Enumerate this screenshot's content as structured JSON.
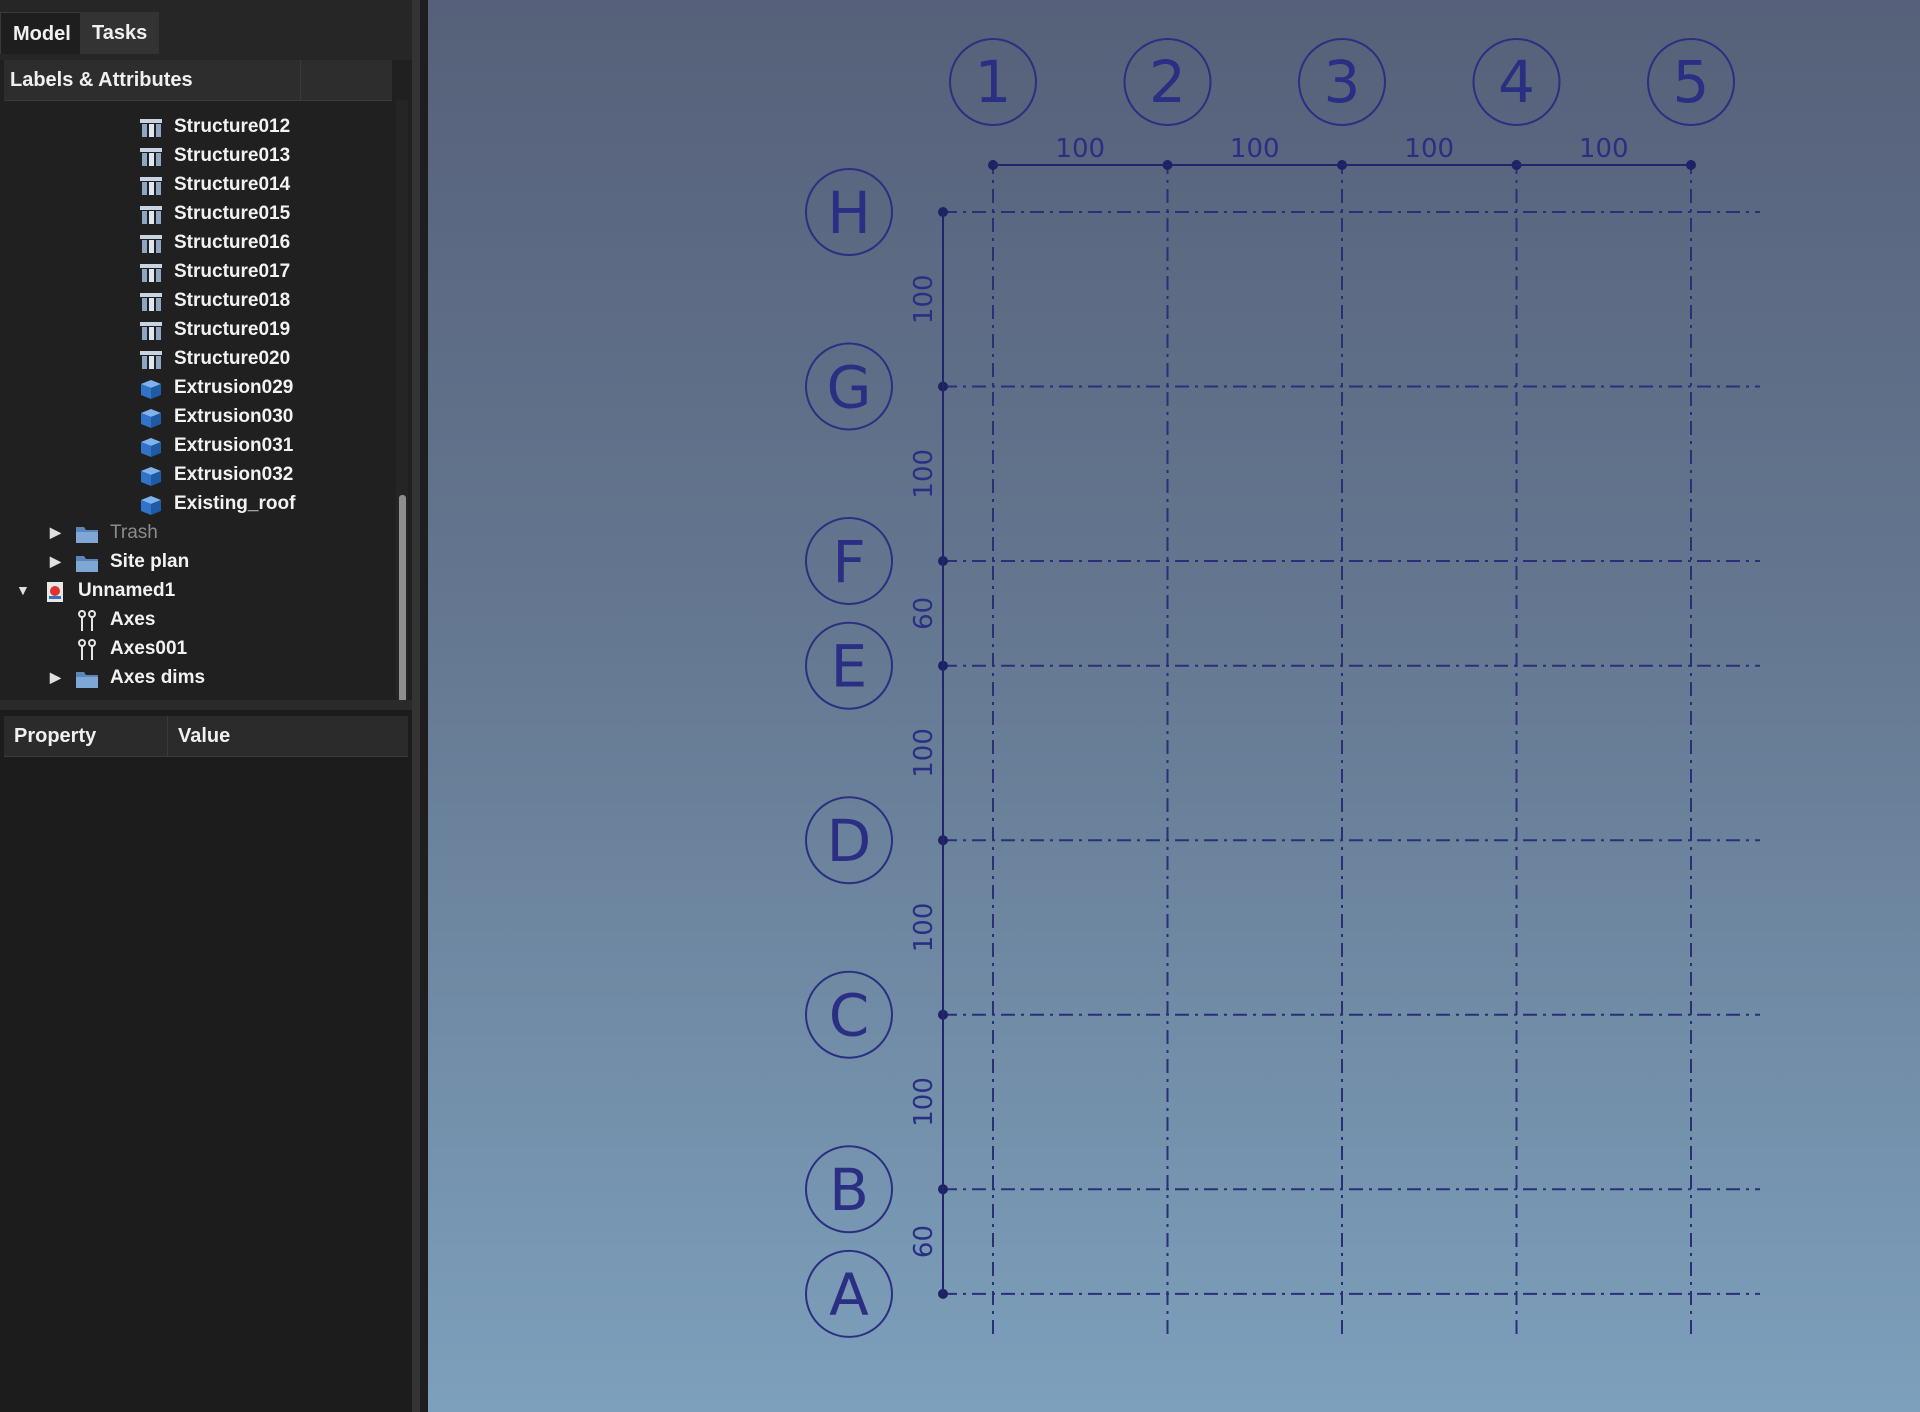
{
  "tabs": [
    {
      "label": "Model",
      "active": true
    },
    {
      "label": "Tasks",
      "active": false
    }
  ],
  "tree": {
    "header": "Labels & Attributes",
    "items": [
      {
        "label": "Structure012",
        "icon": "structure-icon"
      },
      {
        "label": "Structure013",
        "icon": "structure-icon"
      },
      {
        "label": "Structure014",
        "icon": "structure-icon"
      },
      {
        "label": "Structure015",
        "icon": "structure-icon"
      },
      {
        "label": "Structure016",
        "icon": "structure-icon"
      },
      {
        "label": "Structure017",
        "icon": "structure-icon"
      },
      {
        "label": "Structure018",
        "icon": "structure-icon"
      },
      {
        "label": "Structure019",
        "icon": "structure-icon"
      },
      {
        "label": "Structure020",
        "icon": "structure-icon"
      },
      {
        "label": "Extrusion029",
        "icon": "extrusion-icon"
      },
      {
        "label": "Extrusion030",
        "icon": "extrusion-icon"
      },
      {
        "label": "Extrusion031",
        "icon": "extrusion-icon"
      },
      {
        "label": "Extrusion032",
        "icon": "extrusion-icon"
      },
      {
        "label": "Existing_roof",
        "icon": "extrusion-icon"
      },
      {
        "label": "Trash",
        "icon": "folder-icon",
        "expander": "collapsed",
        "dim": true
      },
      {
        "label": "Site plan",
        "icon": "folder-icon",
        "expander": "collapsed"
      },
      {
        "label": "Unnamed1",
        "icon": "document-icon",
        "expander": "expanded"
      },
      {
        "label": "Axes",
        "icon": "axes-icon"
      },
      {
        "label": "Axes001",
        "icon": "axes-icon"
      },
      {
        "label": "Axes dims",
        "icon": "folder-icon",
        "expander": "collapsed"
      }
    ]
  },
  "properties": {
    "col_property": "Property",
    "col_value": "Value"
  },
  "viewport": {
    "column_axes": [
      "1",
      "2",
      "3",
      "4",
      "5"
    ],
    "column_spacings": [
      "100",
      "100",
      "100",
      "100"
    ],
    "row_axes": [
      "H",
      "G",
      "F",
      "E",
      "D",
      "C",
      "B",
      "A"
    ],
    "row_spacings": [
      "100",
      "100",
      "60",
      "100",
      "100",
      "100",
      "60"
    ],
    "colors": {
      "grid_line": "#2a2f78",
      "background_top": "#566079",
      "background_bottom": "#7da0bc"
    }
  }
}
